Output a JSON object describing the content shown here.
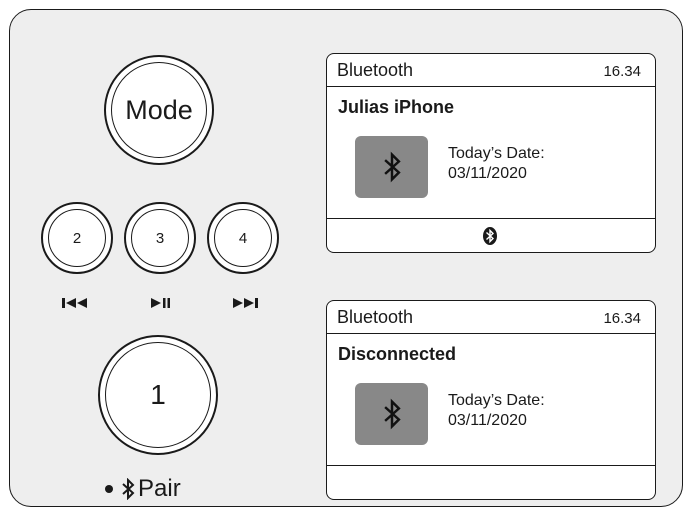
{
  "controls": {
    "mode_label": "Mode",
    "presets": [
      {
        "label": "2",
        "icon": "skip-back-icon"
      },
      {
        "label": "3",
        "icon": "play-pause-icon"
      },
      {
        "label": "4",
        "icon": "skip-forward-icon"
      }
    ],
    "main_button_label": "1",
    "pair_label": "Pair"
  },
  "screens": [
    {
      "source": "Bluetooth",
      "time": "16.34",
      "status": "Julias iPhone",
      "date_label": "Today’s Date:",
      "date_value": "03/11/2020",
      "footer_icon": "bluetooth-connected-icon"
    },
    {
      "source": "Bluetooth",
      "time": "16.34",
      "status": "Disconnected",
      "date_label": "Today’s Date:",
      "date_value": "03/11/2020"
    }
  ],
  "colors": {
    "panel_background": "#eeeeee",
    "outline": "#1a1a1a",
    "bluetooth_tile": "#888888",
    "screen_background": "#ffffff"
  }
}
